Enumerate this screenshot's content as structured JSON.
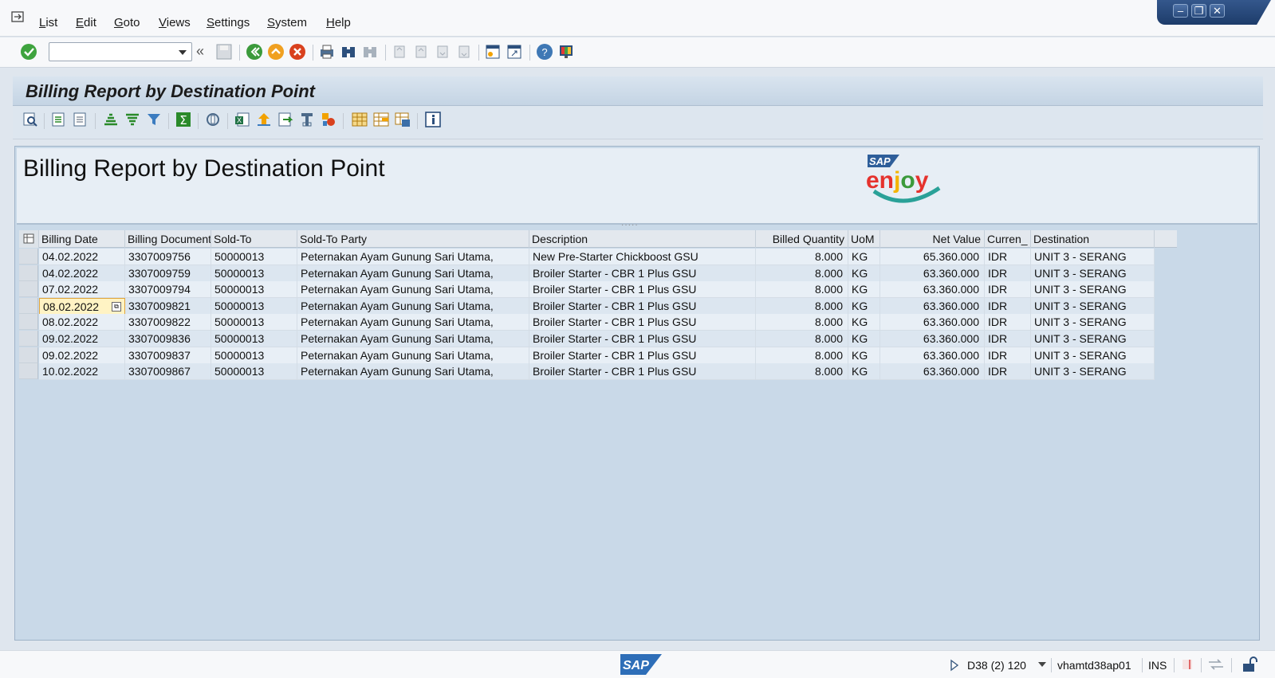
{
  "menu": {
    "items": [
      "List",
      "Edit",
      "Goto",
      "Views",
      "Settings",
      "System",
      "Help"
    ]
  },
  "window_controls": [
    "minimize",
    "restore",
    "close"
  ],
  "title": "Billing Report by Destination Point",
  "report_heading": "Billing Report by Destination Point",
  "logo": {
    "sap": "SAP",
    "enjoy": "enjoy"
  },
  "grid": {
    "columns": [
      "Billing Date",
      "Billing Document",
      "Sold-To",
      "Sold-To Party",
      "Description",
      "Billed Quantity",
      "UoM",
      "Net Value",
      "Curren_",
      "Destination"
    ],
    "rows": [
      [
        "04.02.2022",
        "3307009756",
        "50000013",
        "Peternakan Ayam Gunung Sari Utama,",
        "New Pre-Starter Chickboost GSU",
        "8.000",
        "KG",
        "65.360.000",
        "IDR",
        "UNIT 3 - SERANG"
      ],
      [
        "04.02.2022",
        "3307009759",
        "50000013",
        "Peternakan Ayam Gunung Sari Utama,",
        "Broiler Starter - CBR 1 Plus GSU",
        "8.000",
        "KG",
        "63.360.000",
        "IDR",
        "UNIT 3 - SERANG"
      ],
      [
        "07.02.2022",
        "3307009794",
        "50000013",
        "Peternakan Ayam Gunung Sari Utama,",
        "Broiler Starter - CBR 1 Plus GSU",
        "8.000",
        "KG",
        "63.360.000",
        "IDR",
        "UNIT 3 - SERANG"
      ],
      [
        "08.02.2022",
        "3307009821",
        "50000013",
        "Peternakan Ayam Gunung Sari Utama,",
        "Broiler Starter - CBR 1 Plus GSU",
        "8.000",
        "KG",
        "63.360.000",
        "IDR",
        "UNIT 3 - SERANG"
      ],
      [
        "08.02.2022",
        "3307009822",
        "50000013",
        "Peternakan Ayam Gunung Sari Utama,",
        "Broiler Starter - CBR 1 Plus GSU",
        "8.000",
        "KG",
        "63.360.000",
        "IDR",
        "UNIT 3 - SERANG"
      ],
      [
        "09.02.2022",
        "3307009836",
        "50000013",
        "Peternakan Ayam Gunung Sari Utama,",
        "Broiler Starter - CBR 1 Plus GSU",
        "8.000",
        "KG",
        "63.360.000",
        "IDR",
        "UNIT 3 - SERANG"
      ],
      [
        "09.02.2022",
        "3307009837",
        "50000013",
        "Peternakan Ayam Gunung Sari Utama,",
        "Broiler Starter - CBR 1 Plus GSU",
        "8.000",
        "KG",
        "63.360.000",
        "IDR",
        "UNIT 3 - SERANG"
      ],
      [
        "10.02.2022",
        "3307009867",
        "50000013",
        "Peternakan Ayam Gunung Sari Utama,",
        "Broiler Starter - CBR 1 Plus GSU",
        "8.000",
        "KG",
        "63.360.000",
        "IDR",
        "UNIT 3 - SERANG"
      ]
    ],
    "focused_row": 3
  },
  "status": {
    "system": "D38 (2) 120",
    "server": "vhamtd38ap01",
    "mode": "INS",
    "sap_logo": "SAP"
  },
  "colors": {
    "accent_blue": "#2b4c7e",
    "grid_bg": "#c9d9e8",
    "enjoy_red": "#e5322d",
    "enjoy_yellow": "#f4b400",
    "enjoy_green": "#2aa198"
  }
}
